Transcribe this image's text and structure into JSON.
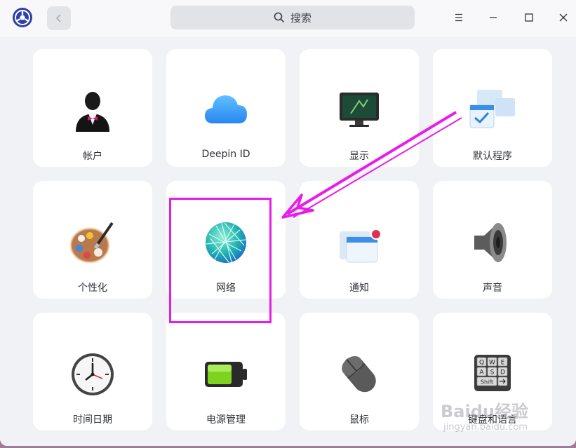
{
  "titlebar": {
    "search_label": "搜索"
  },
  "tiles": [
    {
      "label": "帐户",
      "icon": "account-icon"
    },
    {
      "label": "Deepin ID",
      "icon": "cloud-icon"
    },
    {
      "label": "显示",
      "icon": "display-icon"
    },
    {
      "label": "默认程序",
      "icon": "default-apps-icon"
    },
    {
      "label": "个性化",
      "icon": "palette-icon"
    },
    {
      "label": "网络",
      "icon": "network-globe-icon"
    },
    {
      "label": "通知",
      "icon": "notification-icon"
    },
    {
      "label": "声音",
      "icon": "speaker-icon"
    },
    {
      "label": "时间日期",
      "icon": "clock-icon"
    },
    {
      "label": "电源管理",
      "icon": "battery-icon"
    },
    {
      "label": "鼠标",
      "icon": "mouse-icon"
    },
    {
      "label": "键盘和语言",
      "icon": "keyboard-icon"
    }
  ],
  "keyboard_keys": [
    "Q",
    "W",
    "E",
    "A",
    "S",
    "D",
    "Shift"
  ],
  "watermark": {
    "brand": "Baidu经验",
    "url": "jingyan.baidu.com"
  },
  "colors": {
    "annotation": "#e81ce8",
    "tile_bg": "#ffffff",
    "window_bg": "#f1f2f5"
  }
}
